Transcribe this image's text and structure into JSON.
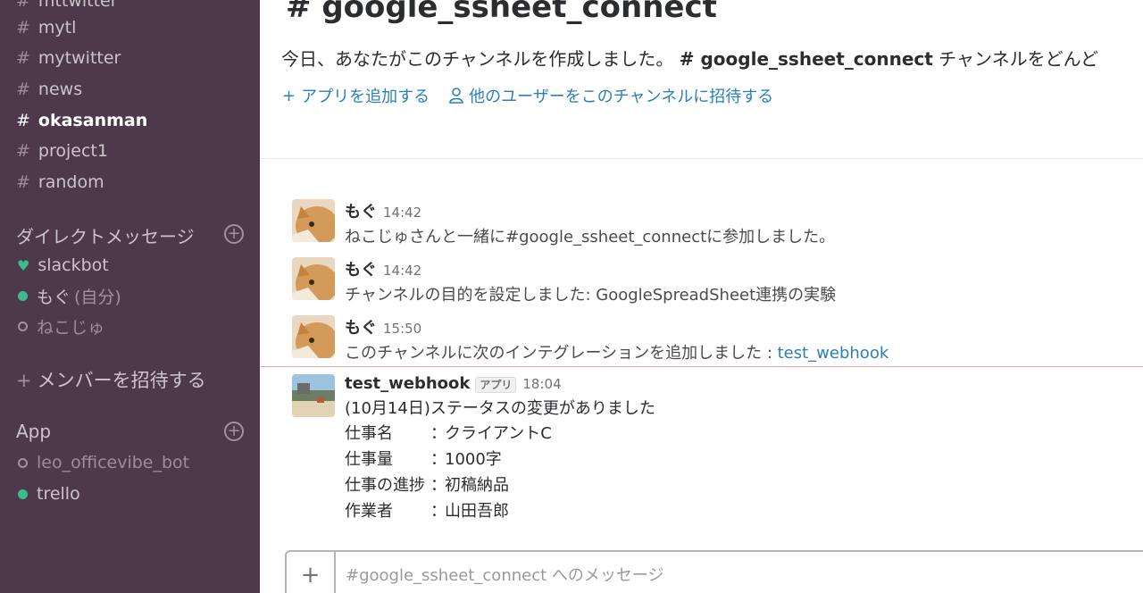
{
  "sidebar": {
    "channels": [
      {
        "name": "mttwitter",
        "bold": false
      },
      {
        "name": "mytl",
        "bold": false
      },
      {
        "name": "mytwitter",
        "bold": false
      },
      {
        "name": "news",
        "bold": false
      },
      {
        "name": "okasanman",
        "bold": true
      },
      {
        "name": "project1",
        "bold": false
      },
      {
        "name": "random",
        "bold": false
      }
    ],
    "hash": "#",
    "dm_header": "ダイレクトメッセージ",
    "dms": [
      {
        "name": "slackbot",
        "status": "heart"
      },
      {
        "name": "もぐ",
        "suffix": "(自分)",
        "status": "online"
      },
      {
        "name": "ねこじゅ",
        "status": "offline"
      }
    ],
    "invite_plus": "+",
    "invite_label": "メンバーを招待する",
    "app_header": "App",
    "apps": [
      {
        "name": "leo_officevibe_bot",
        "status": "offline"
      },
      {
        "name": "trello",
        "status": "online"
      }
    ],
    "add_symbol": "+"
  },
  "channel": {
    "title": "# google_ssheet_connect",
    "intro_prefix": "今日、あなたがこのチャンネルを作成しました。",
    "intro_channel": "# google_ssheet_connect",
    "intro_suffix": "チャンネルをどんど",
    "add_app": "アプリを追加する",
    "add_app_plus": "+",
    "invite_users": "他のユーザーをこのチャンネルに招待する"
  },
  "messages": [
    {
      "author": "もぐ",
      "time": "14:42",
      "text": "ねこじゅさんと一緒に#google_ssheet_connectに参加しました。"
    },
    {
      "author": "もぐ",
      "time": "14:42",
      "text": "チャンネルの目的を設定しました: GoogleSpreadSheet連携の実験"
    },
    {
      "author": "もぐ",
      "time": "15:50",
      "text": "このチャンネルに次のインテグレーションを追加しました : ",
      "link": "test_webhook"
    },
    {
      "author": "test_webhook",
      "badge": "アプリ",
      "time": "18:04",
      "text": "(10月14日)ステータスの変更がありました",
      "fields": [
        {
          "key": "仕事名",
          "sep": "：",
          "value": "クライアントC"
        },
        {
          "key": "仕事量",
          "sep": "：",
          "value": "1000字"
        },
        {
          "key": "仕事の進捗",
          "sep": "：",
          "value": "初稿納品"
        },
        {
          "key": "作業者",
          "sep": "：",
          "value": "山田吾郎"
        }
      ]
    }
  ],
  "composer": {
    "plus": "+",
    "placeholder": "#google_ssheet_connect へのメッセージ"
  },
  "colors": {
    "sidebar_bg": "#4d394b",
    "link": "#2a80b9",
    "online": "#3eb991",
    "new_message_line": "#e5a3a8"
  }
}
